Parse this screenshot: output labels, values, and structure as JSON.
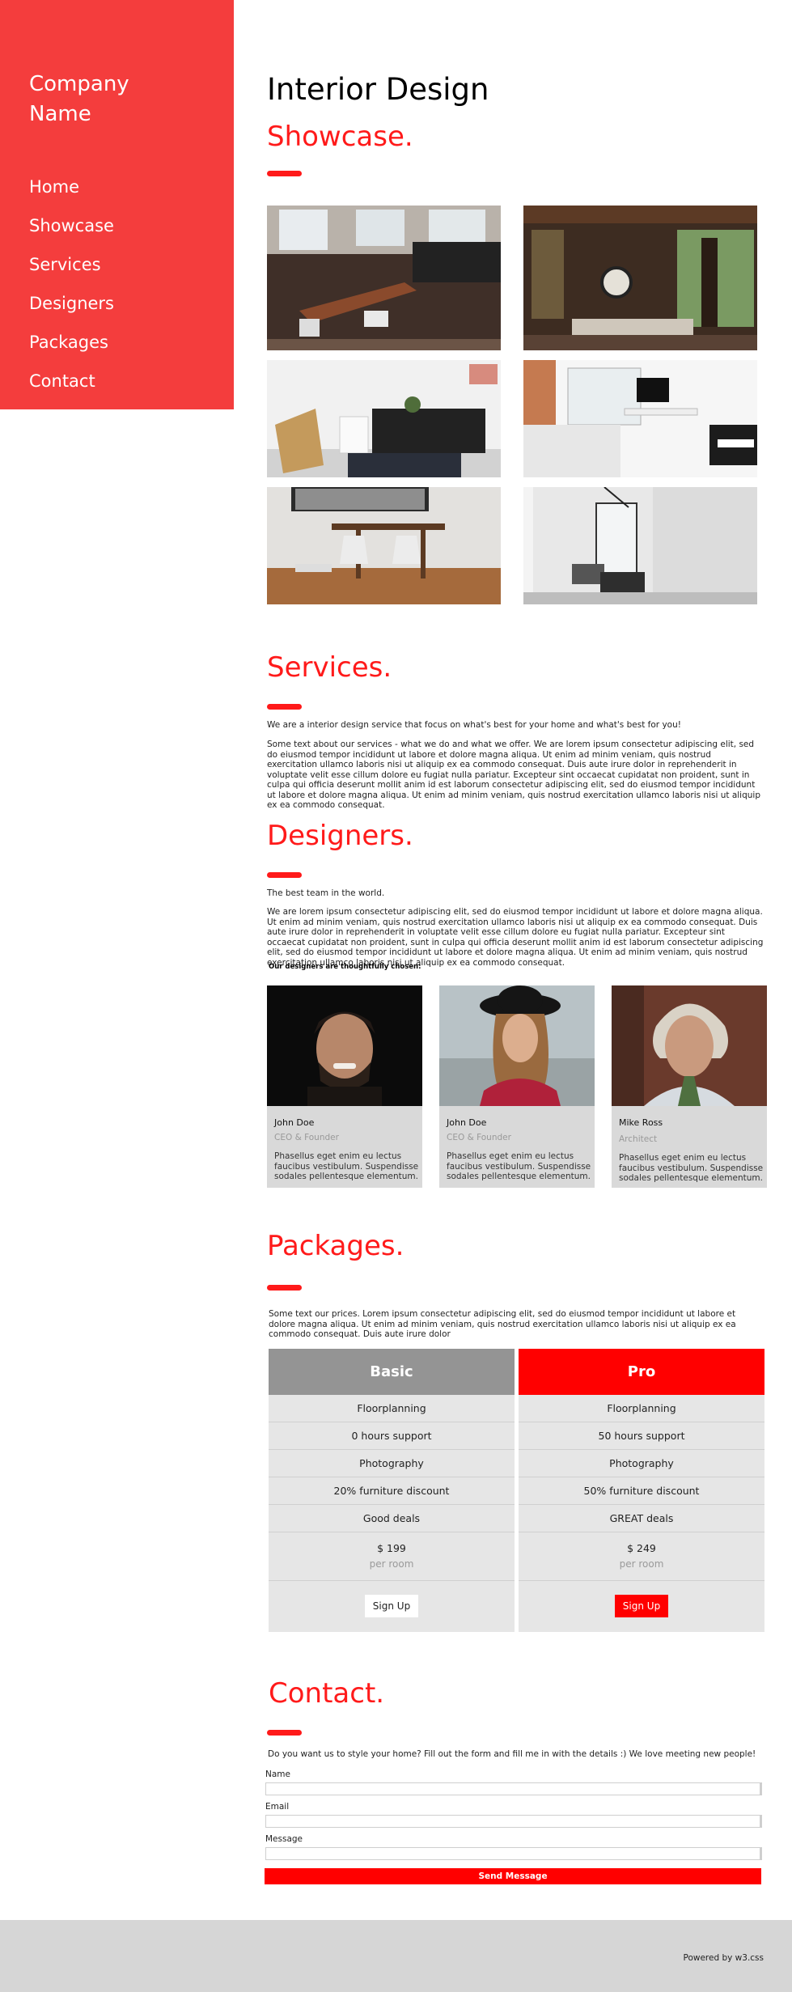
{
  "sidebar": {
    "brand": "Company\nName",
    "nav": [
      "Home",
      "Showcase",
      "Services",
      "Designers",
      "Packages",
      "Contact"
    ]
  },
  "showcase": {
    "title": "Interior Design",
    "subtitle": "Showcase."
  },
  "services": {
    "title": "Services.",
    "lead": "We are a interior design service that focus on what's best for your home and what's best for you!",
    "body": "Some text about our services - what we do and what we offer. We are lorem ipsum consectetur adipiscing elit, sed do eiusmod tempor incididunt ut labore et dolore magna aliqua. Ut enim ad minim veniam, quis nostrud exercitation ullamco laboris nisi ut aliquip ex ea commodo consequat. Duis aute irure dolor in reprehenderit in voluptate velit esse cillum dolore eu fugiat nulla pariatur. Excepteur sint occaecat cupidatat non proident, sunt in culpa qui officia deserunt mollit anim id est laborum consectetur adipiscing elit, sed do eiusmod tempor incididunt ut labore et dolore magna aliqua. Ut enim ad minim veniam, quis nostrud exercitation ullamco laboris nisi ut aliquip ex ea commodo consequat."
  },
  "designers": {
    "title": "Designers.",
    "lead": "The best team in the world.",
    "body": "We are lorem ipsum consectetur adipiscing elit, sed do eiusmod tempor incididunt ut labore et dolore magna aliqua. Ut enim ad minim veniam, quis nostrud exercitation ullamco laboris nisi ut aliquip ex ea commodo consequat. Duis aute irure dolor in reprehenderit in voluptate velit esse cillum dolore eu fugiat nulla pariatur. Excepteur sint occaecat cupidatat non proident, sunt in culpa qui officia deserunt mollit anim id est laborum consectetur adipiscing elit, sed do eiusmod tempor incididunt ut labore et dolore magna aliqua. Ut enim ad minim veniam, quis nostrud exercitation ullamco laboris nisi ut aliquip ex ea commodo consequat.",
    "chosen": "Our designers are thoughtfully chosen:",
    "people": [
      {
        "name": "John Doe",
        "role": "CEO & Founder",
        "desc": "Phasellus eget enim eu lectus faucibus vestibulum. Suspendisse sodales pellentesque elementum."
      },
      {
        "name": "John Doe",
        "role": "CEO & Founder",
        "desc": "Phasellus eget enim eu lectus faucibus vestibulum. Suspendisse sodales pellentesque elementum."
      },
      {
        "name": "Mike Ross",
        "role": "Architect",
        "desc": "Phasellus eget enim eu lectus faucibus vestibulum. Suspendisse sodales pellentesque elementum."
      }
    ]
  },
  "packages": {
    "title": "Packages.",
    "body": "Some text our prices. Lorem ipsum consectetur adipiscing elit, sed do eiusmod tempor incididunt ut labore et dolore magna aliqua. Ut enim ad minim veniam, quis nostrud exercitation ullamco laboris nisi ut aliquip ex ea commodo consequat. Duis aute irure dolor",
    "plans": [
      {
        "name": "Basic",
        "features": [
          "Floorplanning",
          "0 hours support",
          "Photography",
          "20% furniture discount",
          "Good deals"
        ],
        "price": "$ 199",
        "per": "per room",
        "cta": "Sign Up"
      },
      {
        "name": "Pro",
        "features": [
          "Floorplanning",
          "50 hours support",
          "Photography",
          "50% furniture discount",
          "GREAT deals"
        ],
        "price": "$ 249",
        "per": "per room",
        "cta": "Sign Up"
      }
    ]
  },
  "contact": {
    "title": "Contact.",
    "lead": "Do you want us to style your home? Fill out the form and fill me in with the details :) We love meeting new people!",
    "name_label": "Name",
    "email_label": "Email",
    "message_label": "Message",
    "send": "Send Message"
  },
  "footer": {
    "powered": "Powered by w3.css"
  },
  "colors": {
    "accent": "#ff1a1a",
    "sidebar": "#f43d3d",
    "basic_head": "#949494",
    "pro_head": "#ff0000"
  }
}
